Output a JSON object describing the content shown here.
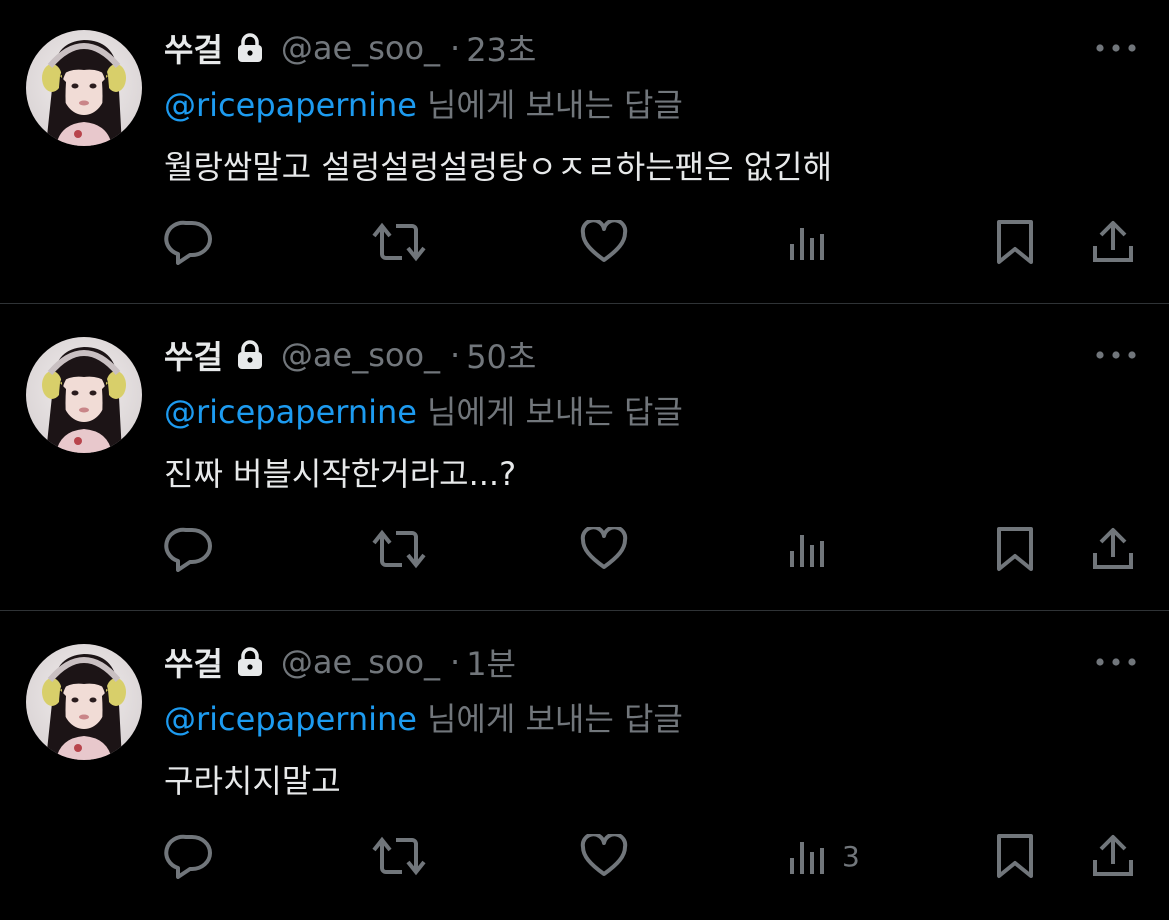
{
  "colors": {
    "background": "#000000",
    "text_primary": "#e7e9ea",
    "text_secondary": "#71767b",
    "accent": "#1d9bf0",
    "divider": "#2f3336"
  },
  "tweets": [
    {
      "display_name": "쑤걸",
      "handle": "@ae_soo_",
      "separator": "·",
      "time": "23초",
      "reply_to": "@ricepapernine",
      "reply_suffix": "님에게 보내는 답글",
      "text": "월랑쌈말고 설렁설렁설렁탕ㅇㅈㄹ하는팬은 없긴해",
      "views_count": ""
    },
    {
      "display_name": "쑤걸",
      "handle": "@ae_soo_",
      "separator": "·",
      "time": "50초",
      "reply_to": "@ricepapernine",
      "reply_suffix": "님에게 보내는 답글",
      "text": "진짜 버블시작한거라고...?",
      "views_count": ""
    },
    {
      "display_name": "쑤걸",
      "handle": "@ae_soo_",
      "separator": "·",
      "time": "1분",
      "reply_to": "@ricepapernine",
      "reply_suffix": "님에게 보내는 답글",
      "text": "구라치지말고",
      "views_count": "3"
    }
  ],
  "icons": {
    "lock": "lock-icon",
    "more": "more-icon",
    "reply": "reply-icon",
    "retweet": "retweet-icon",
    "like": "heart-icon",
    "views": "views-icon",
    "bookmark": "bookmark-icon",
    "share": "share-icon"
  }
}
